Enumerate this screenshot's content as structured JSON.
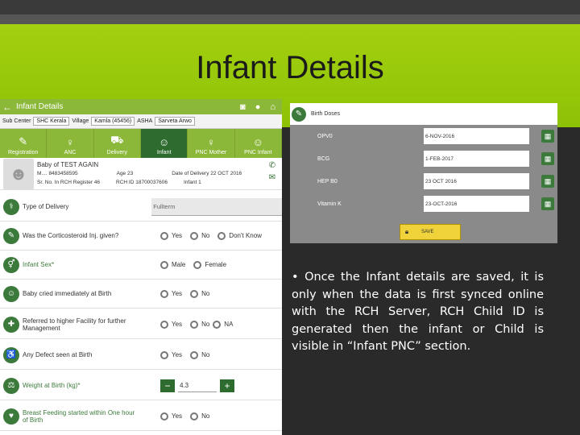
{
  "slide": {
    "title": "Infant Details",
    "bullet_marker": "•",
    "bullet_text": "Once the Infant details are saved, it is only when the data is first synced online with the RCH Server, RCH Child ID is generated then the infant or Child is visible in “Infant PNC” section.",
    "colors": {
      "band": "#a4d010",
      "background": "#2a2a2a",
      "app_green": "#8cb83a",
      "dark_green": "#2e6b2e"
    }
  },
  "infant_screen": {
    "app_bar": {
      "back_icon": "back-arrow-icon",
      "title": "Infant Details",
      "icons": [
        "camera-icon",
        "circle-icon",
        "home-icon"
      ]
    },
    "subheader": {
      "sub_center_label": "Sub Center",
      "sub_center_value": "SHC Kerala",
      "village_label": "Village",
      "village_value": "Kamla (45456)",
      "asha_label": "ASHA",
      "asha_value": "Sarveta Arwo"
    },
    "tabs": [
      {
        "label": "Registration",
        "icon": "registration-icon"
      },
      {
        "label": "ANC",
        "icon": "anc-icon"
      },
      {
        "label": "Delivery",
        "icon": "delivery-icon"
      },
      {
        "label": "Infant",
        "icon": "infant-icon",
        "active": true
      },
      {
        "label": "PNC Mother",
        "icon": "pnc-mother-icon"
      },
      {
        "label": "PNC Infant",
        "icon": "pnc-infant-icon"
      }
    ],
    "profile": {
      "name": "Baby of TEST AGAIN",
      "mobile": "M.... 8483458595",
      "age": "Age 23",
      "delivery_date": "Date of Delivery 22 OCT 2016",
      "rch_status": "Sr. No. In RCH Register 46",
      "rch_id": "RCH ID 18700037606",
      "infant_no": "Infant 1"
    },
    "questions": [
      {
        "label": "Type of Delivery",
        "icon": "delivery-type-icon",
        "field": "Fullterm"
      },
      {
        "label": "Was the Corticosteroid Inj. given?",
        "icon": "injection-icon",
        "options": [
          "Yes",
          "No",
          "Don't Know"
        ]
      },
      {
        "label": "Infant Sex",
        "icon": "gender-icon",
        "required": "*",
        "options": [
          "Male",
          "Female"
        ]
      },
      {
        "label": "Baby cried immediately at Birth",
        "icon": "baby-cry-icon",
        "options": [
          "Yes",
          "No"
        ]
      },
      {
        "label": "Referred to higher Facility for further Management",
        "icon": "referral-icon",
        "options": [
          "Yes",
          "No",
          "NA"
        ]
      },
      {
        "label": "Any Defect seen at Birth",
        "icon": "defect-icon",
        "options": [
          "Yes",
          "No"
        ]
      },
      {
        "label": "Weight at Birth (kg)",
        "icon": "weight-icon",
        "required": "*",
        "stepper_value": "4.3",
        "minus": "−",
        "plus": "+"
      },
      {
        "label": "Breast Feeding started within One hour of Birth",
        "icon": "breastfeeding-icon",
        "options": [
          "Yes",
          "No"
        ]
      }
    ]
  },
  "doses_screen": {
    "header": "Birth Doses",
    "header_icon": "syringe-icon",
    "rows": [
      {
        "label": "OPV0",
        "value": "6-NOV-2016"
      },
      {
        "label": "BCG",
        "value": "1-FEB-2017"
      },
      {
        "label": "HEP B0",
        "value": "23 OCT 2016"
      },
      {
        "label": "Vitamin K",
        "value": "23-OCT-2016"
      }
    ],
    "save_label": "SAVE",
    "save_icon": "lock-icon"
  }
}
